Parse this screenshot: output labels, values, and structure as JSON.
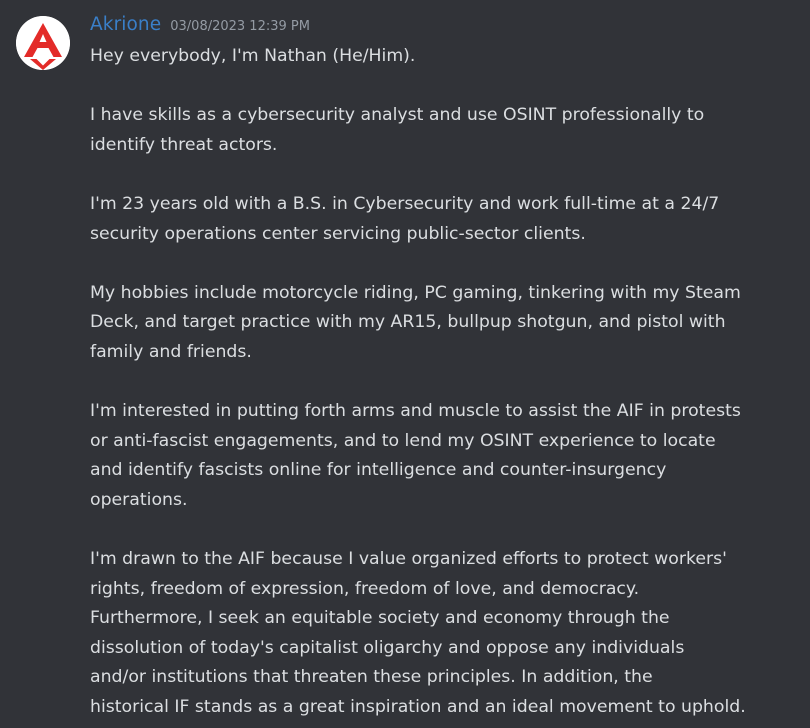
{
  "message": {
    "author": "Akrione",
    "timestamp": "03/08/2023 12:39 PM",
    "avatar_icon": "red-a-logo-icon",
    "colors": {
      "background": "#313338",
      "username": "#3a7fc8",
      "text": "#dbdee1",
      "timestamp": "#949ba4",
      "avatar_red": "#e32b28"
    },
    "lines": [
      "Hey everybody, I'm Nathan (He/Him).",
      "I have skills as a cybersecurity analyst and use OSINT professionally to",
      "identify threat actors.",
      "I'm 23 years old with a B.S. in Cybersecurity and work full-time at a 24/7",
      "security operations center servicing public-sector clients.",
      "My hobbies include motorcycle riding, PC gaming, tinkering with my Steam",
      "Deck, and target practice with my AR15, bullpup shotgun, and pistol with",
      "family and friends.",
      "I'm interested in putting forth arms and muscle to assist the AIF in protests",
      "or anti-fascist engagements, and to lend my OSINT experience to locate",
      "and identify fascists online for intelligence and counter-insurgency",
      "operations.",
      "I'm drawn to the AIF because I value organized efforts to protect workers'",
      "rights, freedom of expression, freedom of love, and democracy.",
      "Furthermore, I seek an equitable society and economy through the",
      "dissolution of today's capitalist oligarchy and oppose any individuals",
      "and/or institutions that threaten these principles. In addition, the",
      "historical IF stands as a great inspiration and an ideal movement to uphold."
    ]
  }
}
